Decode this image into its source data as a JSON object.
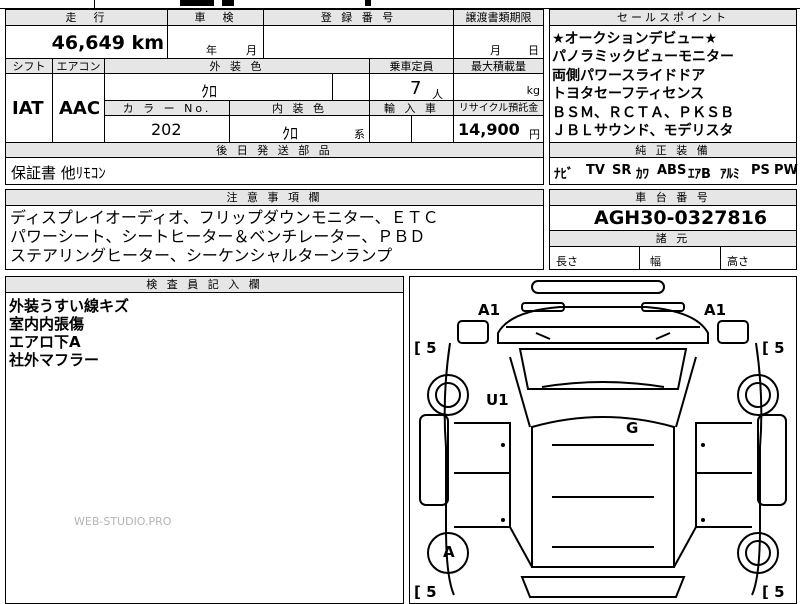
{
  "top_row": {
    "mileage_header": "走　行",
    "inspection_header": "車　検",
    "registration_header": "登 録 番 号",
    "transfer_header": "譲渡書類期限",
    "mileage_value": "46,649 km",
    "inspection_year": "年",
    "inspection_month": "月",
    "transfer_month": "月",
    "transfer_day": "日"
  },
  "spec_row": {
    "shift_header": "シフト",
    "ac_header": "エアコン",
    "exterior_header": "外 装 色",
    "capacity_header": "乗車定員",
    "max_load_header": "最大積載量",
    "shift_value": "IAT",
    "ac_value": "AAC",
    "exterior_value": "ｸﾛ",
    "capacity_value": "7",
    "capacity_unit": "人",
    "max_load_unit": "kg",
    "color_no_header": "カ ラ ー No.",
    "interior_header": "内 装 色",
    "import_header": "輸 入 車",
    "recycle_header": "リサイクル預託金",
    "color_no_value": "202",
    "interior_value": "ｸﾛ",
    "interior_unit": "系",
    "recycle_value": "14,900",
    "recycle_unit": "円"
  },
  "delivery": {
    "header": "後 日 発 送 部 品",
    "value": "保証書  他ﾘﾓｺﾝ"
  },
  "selling_points": {
    "header": "セールスポイント",
    "lines": [
      "★オークションデビュー★",
      "パノラミックビューモニター",
      "両側パワースライドドア",
      "トヨタセーフティセンス",
      "ＢＳＭ、ＲＣＴＡ、ＰＫＳＢ",
      "ＪＢＬサウンド、モデリスタ"
    ]
  },
  "equipment": {
    "header": "純 正 装 備",
    "items": [
      "ﾅﾋﾞ",
      "TV",
      "SR",
      "ｶﾜ",
      "ABS",
      "ｴｱB",
      "ｱﾙﾐ",
      "PS",
      "PW"
    ]
  },
  "notes": {
    "header": "注 意 事 項 欄",
    "lines": [
      "ディスプレイオーディオ、フリップダウンモニター、ＥＴＣ",
      "パワーシート、シートヒーター＆ベンチレーター、ＰＢＤ",
      "ステアリングヒーター、シーケンシャルターンランプ"
    ]
  },
  "chassis": {
    "header": "車 台 番 号",
    "value": "AGH30-0327816"
  },
  "dimensions": {
    "header": "諸 元",
    "length": "長さ",
    "width": "幅",
    "height": "高さ"
  },
  "inspector": {
    "header": "検 査 員 記 入 欄",
    "lines": [
      "外装うすい線キズ",
      "室内内張傷",
      "エアロ下A",
      "社外マフラー"
    ]
  },
  "diagram": {
    "labels": {
      "a1_left": "A1",
      "a1_right": "A1",
      "u1": "U1",
      "g": "G",
      "a": "A",
      "tire": "5"
    }
  },
  "watermark": "WEB-STUDIO.PRO"
}
